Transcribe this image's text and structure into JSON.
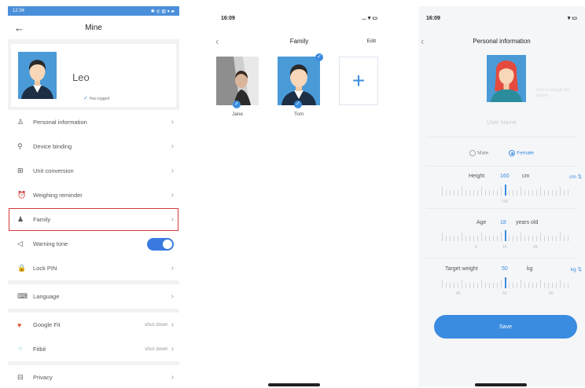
{
  "screen1": {
    "status_time": "12:34",
    "status_icons": "✱ ◎ ▥ ▾ ▰",
    "title": "Mine",
    "profile": {
      "name": "Leo",
      "logged": "Has logged"
    },
    "menu": [
      {
        "key": "personal",
        "icon": "person-icon",
        "glyph": "♙",
        "label": "Personal information",
        "value": ""
      },
      {
        "key": "device",
        "icon": "link-icon",
        "glyph": "⚲",
        "label": "Device binding",
        "value": ""
      },
      {
        "key": "unit",
        "icon": "unit-icon",
        "glyph": "⊞",
        "label": "Unit conversion",
        "value": ""
      },
      {
        "key": "reminder",
        "icon": "alarm-icon",
        "glyph": "⏰",
        "label": "Weighing reminder",
        "value": ""
      },
      {
        "key": "family",
        "icon": "family-icon",
        "glyph": "♟",
        "label": "Family",
        "value": ""
      },
      {
        "key": "tone",
        "icon": "speaker-icon",
        "glyph": "◁",
        "label": "Warning tone",
        "value": ""
      },
      {
        "key": "lock",
        "icon": "lock-icon",
        "glyph": "🔒",
        "label": "Lock PIN",
        "value": ""
      }
    ],
    "menu2": [
      {
        "key": "language",
        "icon": "keyboard-icon",
        "glyph": "⌨",
        "label": "Language",
        "value": ""
      }
    ],
    "menu3": [
      {
        "key": "googlefit",
        "icon": "heart-icon",
        "glyph": "♥",
        "label": "Google Fit",
        "value": "shut down"
      },
      {
        "key": "fitbit",
        "icon": "fitbit-icon",
        "glyph": "⁘",
        "label": "Fitbit",
        "value": "shut down"
      }
    ],
    "menu4": [
      {
        "key": "privacy",
        "icon": "privacy-icon",
        "glyph": "⊟",
        "label": "Privacy",
        "value": ""
      }
    ],
    "colors": {
      "accent": "#3a7ae0",
      "highlight": "#d83a3a",
      "status_bar": "#4a8fd9"
    }
  },
  "screen2": {
    "status_time": "16:09",
    "status_icons": "... ▾ ▭",
    "title": "Family",
    "edit": "Edit",
    "members": [
      {
        "name": "Jane"
      },
      {
        "name": "Tom"
      }
    ],
    "add_glyph": "+"
  },
  "screen3": {
    "status_time": "16:09",
    "status_icons": "▾ ▭",
    "title": "Personal information",
    "avatar_hint": "Click to change the picture",
    "username_placeholder": "User Name",
    "gender": {
      "male": "Male",
      "female": "Female",
      "selected": "female"
    },
    "height": {
      "label": "Height",
      "value": "160",
      "unit": "cm",
      "switch": "cm ⇅",
      "ruler_labels": [
        "160"
      ]
    },
    "age": {
      "label": "Age",
      "value": "18",
      "unit": "years old",
      "ruler_labels": [
        "8",
        "18",
        "28"
      ]
    },
    "target": {
      "label": "Target weight",
      "value": "50",
      "unit": "kg",
      "switch": "kg ⇅",
      "ruler_labels": [
        "40",
        "50",
        "60"
      ]
    },
    "save": "Save"
  }
}
